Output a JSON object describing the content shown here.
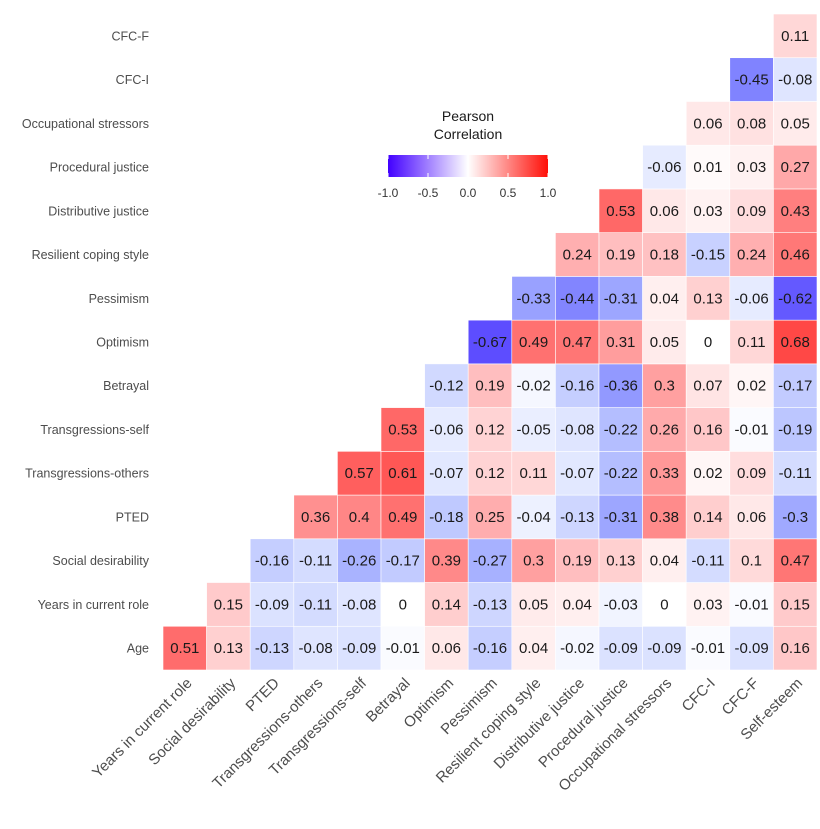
{
  "chart_data": {
    "type": "heatmap",
    "title": "",
    "xlabel": "",
    "ylabel": "",
    "variables": [
      "Age",
      "Years in current role",
      "Social desirability",
      "PTED",
      "Transgressions-others",
      "Transgressions-self",
      "Betrayal",
      "Optimism",
      "Pessimism",
      "Resilient coping style",
      "Distributive justice",
      "Procedural justice",
      "Occupational stressors",
      "CFC-I",
      "CFC-F",
      "Self-esteem"
    ],
    "x_categories": [
      "Years in current role",
      "Social desirability",
      "PTED",
      "Transgressions-others",
      "Transgressions-self",
      "Betrayal",
      "Optimism",
      "Pessimism",
      "Resilient coping style",
      "Distributive justice",
      "Procedural justice",
      "Occupational stressors",
      "CFC-I",
      "CFC-F",
      "Self-esteem"
    ],
    "y_categories": [
      "Age",
      "Years in current role",
      "Social desirability",
      "PTED",
      "Transgressions-others",
      "Transgressions-self",
      "Betrayal",
      "Optimism",
      "Pessimism",
      "Resilient coping style",
      "Distributive justice",
      "Procedural justice",
      "Occupational stressors",
      "CFC-I",
      "CFC-F"
    ],
    "y_order_note": "y_categories listed bottom-to-top",
    "rows": [
      {
        "row": "Age",
        "values": [
          0.51,
          0.13,
          -0.13,
          -0.08,
          -0.09,
          -0.01,
          0.06,
          -0.16,
          0.04,
          -0.02,
          -0.09,
          -0.09,
          -0.01,
          -0.09,
          0.16
        ]
      },
      {
        "row": "Years in current role",
        "values": [
          null,
          0.15,
          -0.09,
          -0.11,
          -0.08,
          0,
          0.14,
          -0.13,
          0.05,
          0.04,
          -0.03,
          0,
          0.03,
          -0.01,
          0.15
        ]
      },
      {
        "row": "Social desirability",
        "values": [
          null,
          null,
          -0.16,
          -0.11,
          -0.26,
          -0.17,
          0.39,
          -0.27,
          0.3,
          0.19,
          0.13,
          0.04,
          -0.11,
          0.1,
          0.47
        ]
      },
      {
        "row": "PTED",
        "values": [
          null,
          null,
          null,
          0.36,
          0.4,
          0.49,
          -0.18,
          0.25,
          -0.04,
          -0.13,
          -0.31,
          0.38,
          0.14,
          0.06,
          -0.3
        ]
      },
      {
        "row": "Transgressions-others",
        "values": [
          null,
          null,
          null,
          null,
          0.57,
          0.61,
          -0.07,
          0.12,
          0.11,
          -0.07,
          -0.22,
          0.33,
          0.02,
          0.09,
          -0.11
        ]
      },
      {
        "row": "Transgressions-self",
        "values": [
          null,
          null,
          null,
          null,
          null,
          0.53,
          -0.06,
          0.12,
          -0.05,
          -0.08,
          -0.22,
          0.26,
          0.16,
          -0.01,
          -0.19
        ]
      },
      {
        "row": "Betrayal",
        "values": [
          null,
          null,
          null,
          null,
          null,
          null,
          -0.12,
          0.19,
          -0.02,
          -0.16,
          -0.36,
          0.3,
          0.07,
          0.02,
          -0.17
        ]
      },
      {
        "row": "Optimism",
        "values": [
          null,
          null,
          null,
          null,
          null,
          null,
          null,
          -0.67,
          0.49,
          0.47,
          0.31,
          0.05,
          0,
          0.11,
          0.68
        ]
      },
      {
        "row": "Pessimism",
        "values": [
          null,
          null,
          null,
          null,
          null,
          null,
          null,
          null,
          -0.33,
          -0.44,
          -0.31,
          0.04,
          0.13,
          -0.06,
          -0.62
        ]
      },
      {
        "row": "Resilient coping style",
        "values": [
          null,
          null,
          null,
          null,
          null,
          null,
          null,
          null,
          null,
          0.24,
          0.19,
          0.18,
          -0.15,
          0.24,
          0.46
        ]
      },
      {
        "row": "Distributive justice",
        "values": [
          null,
          null,
          null,
          null,
          null,
          null,
          null,
          null,
          null,
          null,
          0.53,
          0.06,
          0.03,
          0.09,
          0.43
        ]
      },
      {
        "row": "Procedural justice",
        "values": [
          null,
          null,
          null,
          null,
          null,
          null,
          null,
          null,
          null,
          null,
          null,
          -0.06,
          0.01,
          0.03,
          0.27
        ]
      },
      {
        "row": "Occupational stressors",
        "values": [
          null,
          null,
          null,
          null,
          null,
          null,
          null,
          null,
          null,
          null,
          null,
          null,
          0.06,
          0.08,
          0.05
        ]
      },
      {
        "row": "CFC-I",
        "values": [
          null,
          null,
          null,
          null,
          null,
          null,
          null,
          null,
          null,
          null,
          null,
          null,
          null,
          -0.45,
          -0.08
        ]
      },
      {
        "row": "CFC-F",
        "values": [
          null,
          null,
          null,
          null,
          null,
          null,
          null,
          null,
          null,
          null,
          null,
          null,
          null,
          null,
          0.11
        ]
      }
    ],
    "color_scale": {
      "low": "#0000FF",
      "mid": "#FFFFFF",
      "high": "#FF0000",
      "limits": [
        -1.0,
        1.0
      ]
    },
    "legend": {
      "title_line1": "Pearson",
      "title_line2": "Correlation",
      "ticks": [
        "-1.0",
        "-0.5",
        "0.0",
        "0.5",
        "1.0"
      ],
      "tick_values": [
        -1.0,
        -0.5,
        0.0,
        0.5,
        1.0
      ],
      "placement": "upper-middle"
    },
    "grid": false
  }
}
